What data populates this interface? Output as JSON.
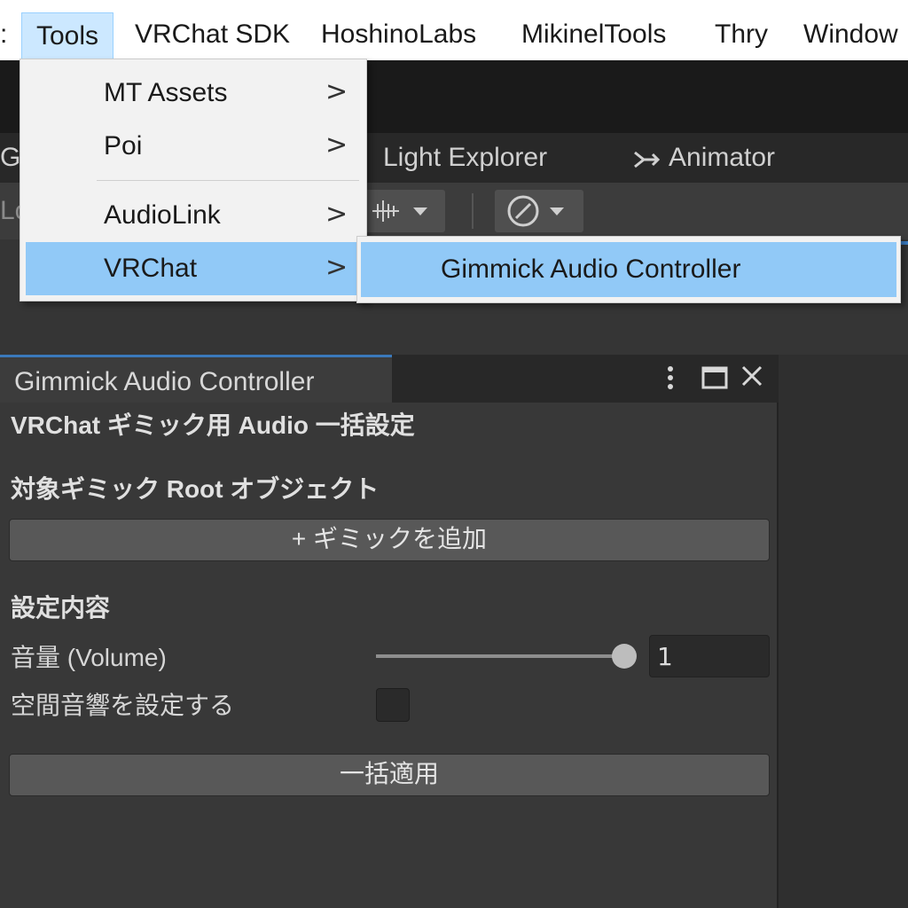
{
  "menubar": {
    "partial_left": ":",
    "items": [
      "Tools",
      "VRChat SDK",
      "HoshinoLabs",
      "MikinelTools",
      "Thry",
      "Window"
    ]
  },
  "editor": {
    "tabs": {
      "partial_game": "Ga",
      "light_explorer": "Light Explorer",
      "animator": "Animator"
    },
    "toolbar_partial": "Lo"
  },
  "tools_menu": {
    "items": [
      {
        "label": "MT Assets",
        "arrow": ">"
      },
      {
        "label": "Poi",
        "arrow": ">"
      },
      {
        "label": "AudioLink",
        "arrow": ">"
      },
      {
        "label": "VRChat",
        "arrow": ">"
      }
    ]
  },
  "submenu": {
    "item": "Gimmick Audio Controller"
  },
  "window": {
    "tab_title": "Gimmick Audio Controller",
    "heading": "VRChat ギミック用 Audio 一括設定",
    "root_section_label": "対象ギミック Root オブジェクト",
    "add_gimmick_button": "+ ギミックを追加",
    "settings_section_label": "設定内容",
    "volume_label": "音量 (Volume)",
    "volume_value": "1",
    "volume_fraction": 1.0,
    "spatial_label": "空間音響を設定する",
    "spatial_checked": false,
    "apply_button": "一括適用"
  },
  "colors": {
    "menu_highlight": "#91c9f7",
    "active_menubar": "#cce8ff",
    "tab_accent": "#3a79bb",
    "editor_bg": "#383838"
  }
}
